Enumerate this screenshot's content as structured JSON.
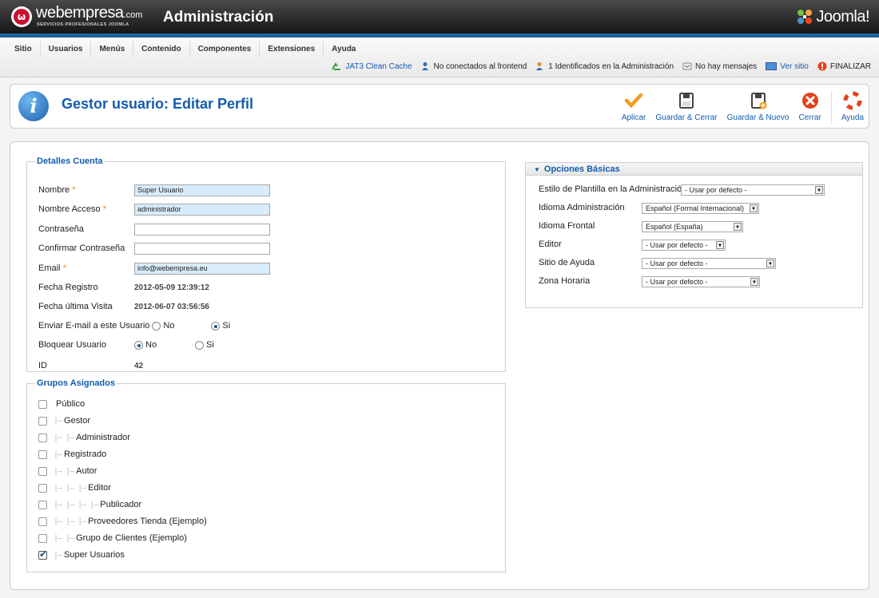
{
  "header": {
    "brand_name": "webempresa",
    "brand_domain": ".com",
    "brand_tagline": "SERVICIOS PROFESIONALES JOOMLA",
    "title": "Administración",
    "joomla_word": "Joomla!"
  },
  "menu": [
    "Sitio",
    "Usuarios",
    "Menús",
    "Contenido",
    "Componentes",
    "Extensiones",
    "Ayuda"
  ],
  "status": {
    "cache": "JAT3 Clean Cache",
    "frontend": "No conectados al frontend",
    "admin": "1 Identificados en la Administración",
    "messages": "No hay mensajes",
    "view_site": "Ver sitio",
    "logout": "FINALIZAR"
  },
  "toolbar": {
    "page_title": "Gestor usuario: Editar Perfil",
    "apply": "Aplicar",
    "save_close": "Guardar & Cerrar",
    "save_new": "Guardar & Nuevo",
    "close": "Cerrar",
    "help": "Ayuda"
  },
  "details": {
    "legend": "Detalles Cuenta",
    "name_label": "Nombre",
    "name_value": "Super Usuario",
    "login_label": "Nombre Acceso",
    "login_value": "administrador",
    "password_label": "Contraseña",
    "confirm_label": "Confirmar Contraseña",
    "email_label": "Email",
    "email_value": "info@webempresa.eu",
    "registered_label": "Fecha Registro",
    "registered_value": "2012-05-09 12:39:12",
    "lastvisit_label": "Fecha última Visita",
    "lastvisit_value": "2012-06-07 03:56:56",
    "sendmail_label": "Enviar E-mail a este Usuario",
    "block_label": "Bloquear Usuario",
    "no": "No",
    "yes": "Si",
    "sendmail_selected": "Si",
    "block_selected": "No",
    "id_label": "ID",
    "id_value": "42",
    "required_mark": "*"
  },
  "groups": {
    "legend": "Grupos Asignados",
    "items": [
      {
        "label": "Público",
        "depth": 0,
        "checked": false
      },
      {
        "label": "Gestor",
        "depth": 1,
        "checked": false
      },
      {
        "label": "Administrador",
        "depth": 2,
        "checked": false
      },
      {
        "label": "Registrado",
        "depth": 1,
        "checked": false
      },
      {
        "label": "Autor",
        "depth": 2,
        "checked": false
      },
      {
        "label": "Editor",
        "depth": 3,
        "checked": false
      },
      {
        "label": "Publicador",
        "depth": 4,
        "checked": false
      },
      {
        "label": "Proveedores Tienda (Ejemplo)",
        "depth": 3,
        "checked": false
      },
      {
        "label": "Grupo de Clientes (Ejemplo)",
        "depth": 2,
        "checked": false
      },
      {
        "label": "Super Usuarios",
        "depth": 1,
        "checked": true
      }
    ]
  },
  "options": {
    "heading": "Opciones Básicas",
    "admin_template_label": "Estilo de Plantilla en la Administración",
    "admin_template_value": "- Usar por defecto -",
    "admin_lang_label": "Idioma Administración",
    "admin_lang_value": "Español (Formal Internacional)",
    "site_lang_label": "Idioma Frontal",
    "site_lang_value": "Español (España)",
    "editor_label": "Editor",
    "editor_value": "- Usar por defecto -",
    "help_site_label": "Sitio de Ayuda",
    "help_site_value": "- Usar por defecto -",
    "timezone_label": "Zona Horaria",
    "timezone_value": "- Usar por defecto -"
  },
  "colors": {
    "accent_blue": "#135cae",
    "header_dark": "#161616",
    "stripe_blue": "#1d6fa8",
    "required_orange": "#e8870c",
    "field_highlight": "#d8ecfb"
  }
}
